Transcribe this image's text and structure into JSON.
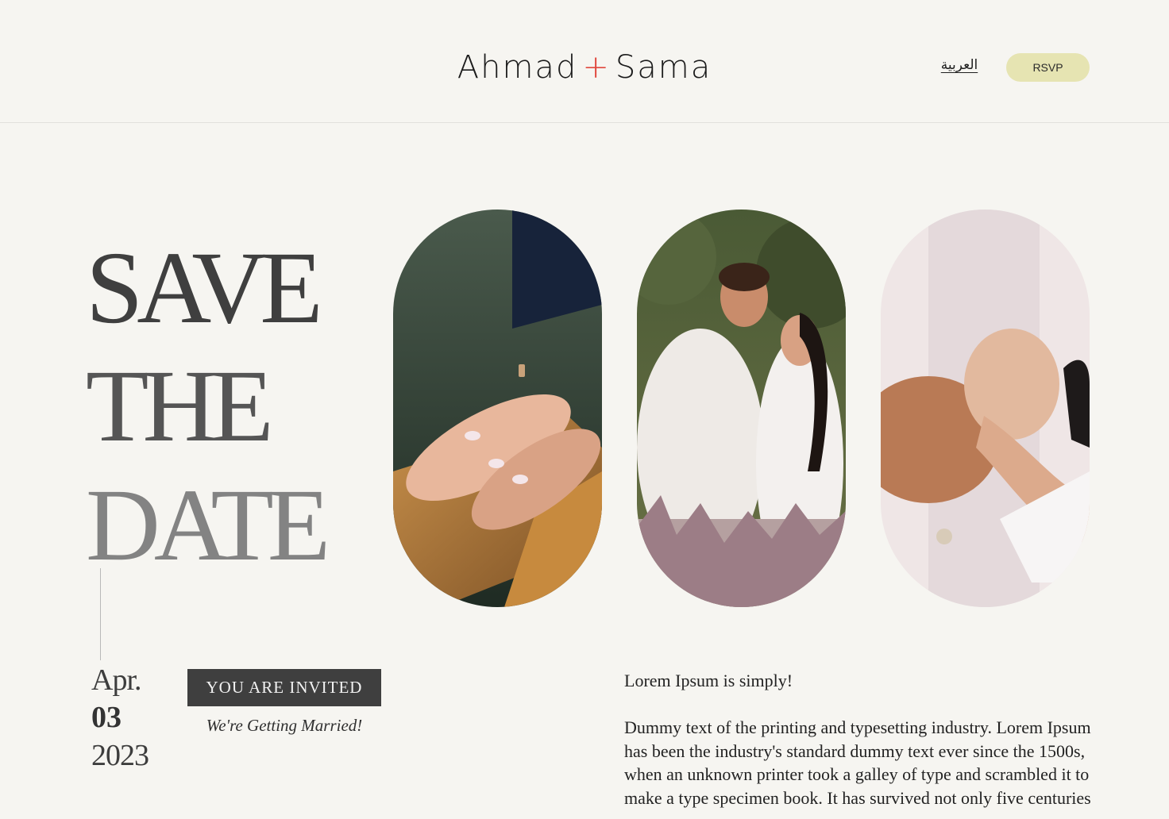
{
  "header": {
    "brand_left": "Ahmad",
    "brand_plus": "+",
    "brand_right": "Sama",
    "language_link": "العربية",
    "rsvp_label": "RSVP"
  },
  "hero": {
    "line1": "SAVE",
    "line2": "THE",
    "line3": "DATE"
  },
  "date": {
    "month": "Apr.",
    "day": "03",
    "year": "2023"
  },
  "invite": {
    "badge": "YOU ARE INVITED",
    "tagline": "We're Getting Married!"
  },
  "content": {
    "lead": "Lorem Ipsum is simply!",
    "body": "Dummy text of the printing and typesetting industry. Lorem Ipsum has been the industry's standard dummy text ever since the 1500s, when an unknown printer took a galley of type and scrambled it to make a type specimen book. It has survived not only five centuries"
  },
  "colors": {
    "background": "#f6f5f1",
    "accent_plus": "#e0473d",
    "rsvp_bg": "#e6e4b2",
    "badge_bg": "#3f3f3f"
  }
}
